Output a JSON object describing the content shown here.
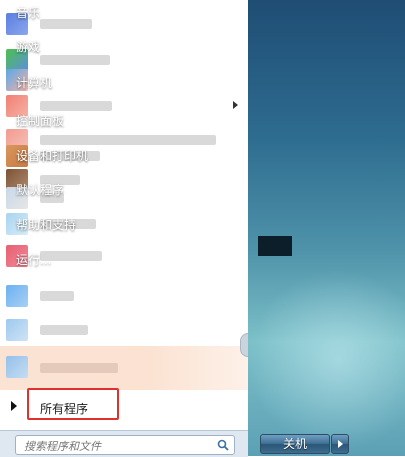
{
  "left_pane": {
    "all_programs_label": "所有程序",
    "program_icon_colors": [
      "#5b7fe0",
      "#7cc45b",
      "#59a7e8",
      "#f07f73",
      "#f29a8f",
      "#d9975c",
      "#7b5236",
      "#c8d8e8",
      "#a8d4ef",
      "#e55f72",
      "#6db0f0",
      "#9cc9ee",
      "#8fbde8"
    ]
  },
  "right_pane": {
    "items": [
      {
        "label": "音乐",
        "has_submenu": false
      },
      {
        "label": "游戏",
        "has_submenu": false
      },
      {
        "label": "计算机",
        "has_submenu": false
      },
      {
        "label": "控制面板",
        "has_submenu": false
      },
      {
        "label": "设备和打印机",
        "has_submenu": false
      },
      {
        "label": "默认程序",
        "has_submenu": false
      },
      {
        "label": "帮助和支持",
        "has_submenu": false
      },
      {
        "label": "运行...",
        "has_submenu": false
      }
    ]
  },
  "search": {
    "placeholder": "搜索程序和文件"
  },
  "shutdown": {
    "label": "关机"
  },
  "colors": {
    "highlight_border": "#e0312e",
    "right_pane_top": "#1f4d74",
    "right_pane_bottom": "#7cc0c8"
  }
}
